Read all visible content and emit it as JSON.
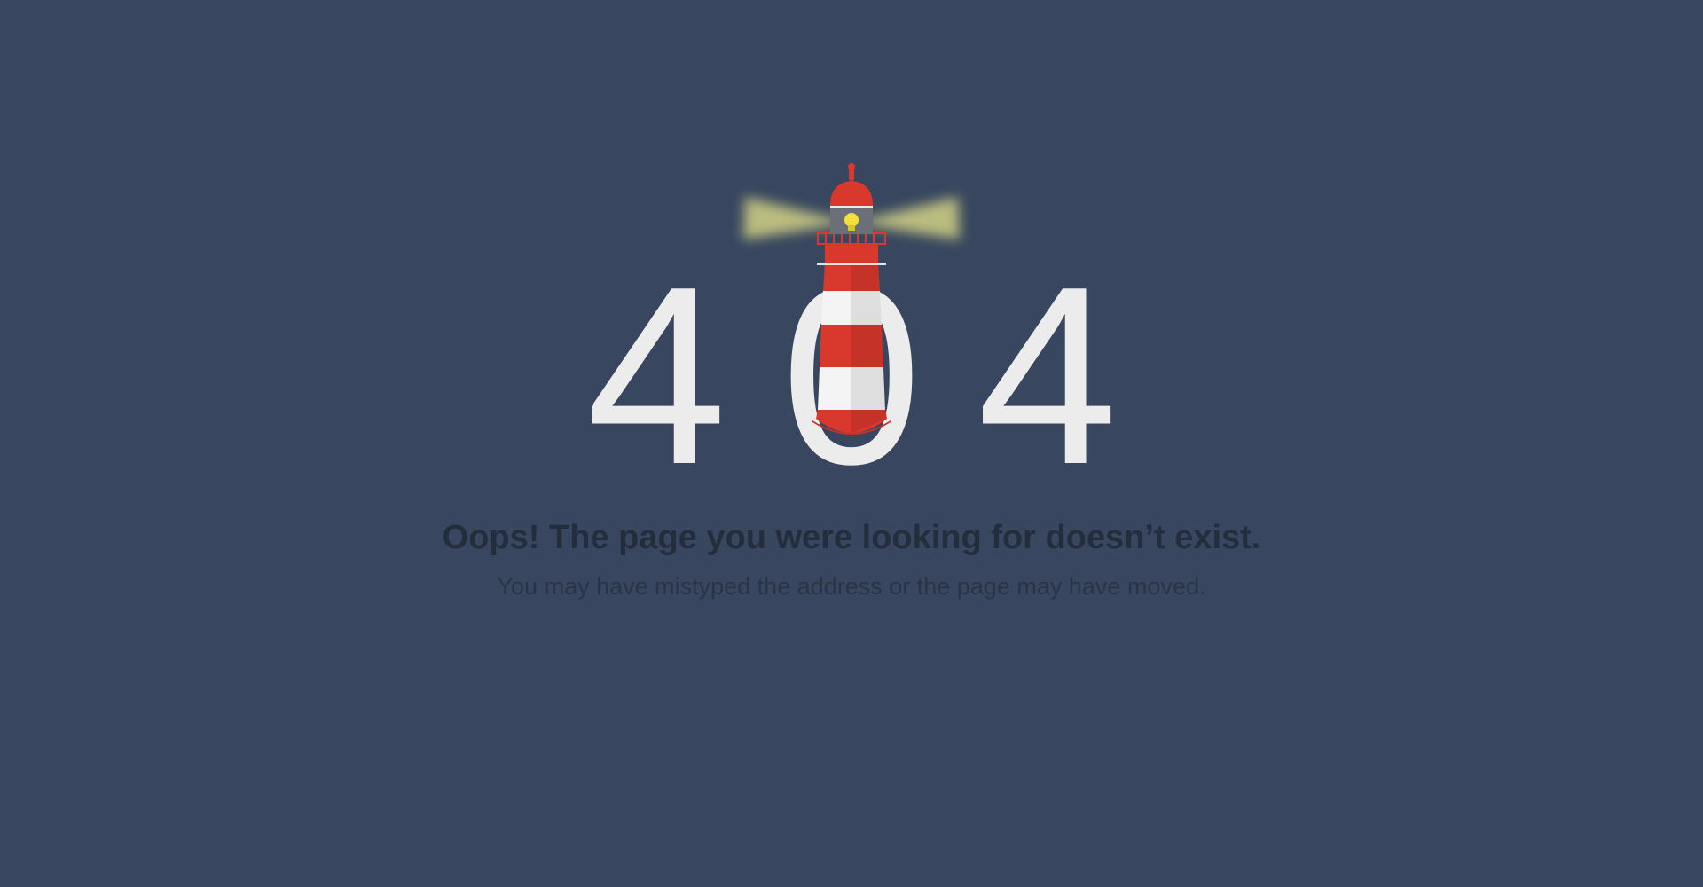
{
  "error": {
    "code": "404",
    "digit_left": "4",
    "digit_middle": "0",
    "digit_right": "4",
    "headline": "Oops! The page you were looking for doesn’t exist.",
    "subline": "You may have mistyped the address or the page may have moved."
  },
  "illustration": {
    "icon": "lighthouse-icon"
  },
  "colors": {
    "background": "#38475f",
    "digits": "#ececec",
    "lighthouse_red": "#d9382c",
    "lighthouse_white": "#f4f4f4",
    "lamp": "#f3e03a",
    "beam": "#e7e48a",
    "headline": "#232d3c",
    "subline": "#2a3445"
  }
}
